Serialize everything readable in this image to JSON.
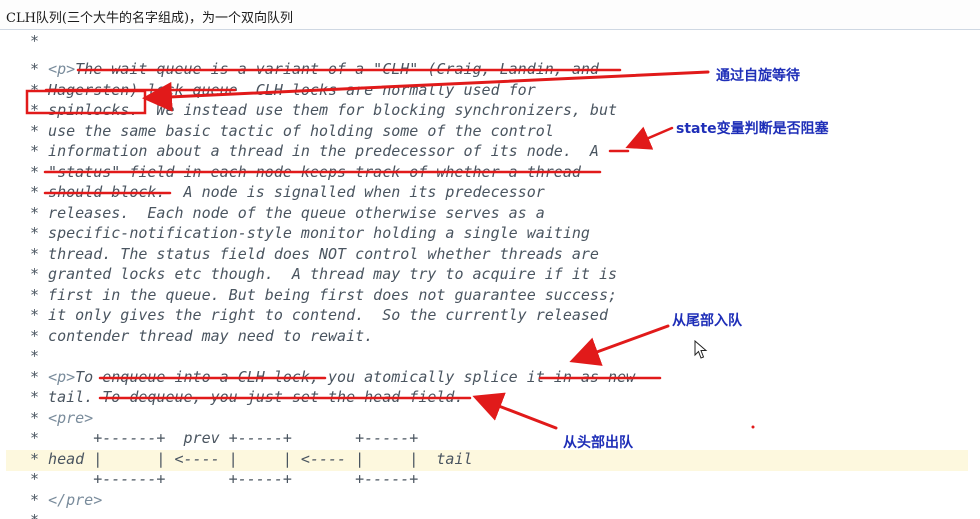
{
  "window": {
    "title": "CLH队列(三个大牛的名字组成)，为一个双向队列"
  },
  "code": {
    "lines": [
      "*",
      "* <p>The wait queue is a variant of a \"CLH\" (Craig, Landin, and",
      "* Hagersten) lock queue. CLH locks are normally used for",
      "* spinlocks.  We instead use them for blocking synchronizers, but",
      "* use the same basic tactic of holding some of the control",
      "* information about a thread in the predecessor of its node.  A",
      "* \"status\" field in each node keeps track of whether a thread",
      "* should block.  A node is signalled when its predecessor",
      "* releases.  Each node of the queue otherwise serves as a",
      "* specific-notification-style monitor holding a single waiting",
      "* thread. The status field does NOT control whether threads are",
      "* granted locks etc though.  A thread may try to acquire if it is",
      "* first in the queue. But being first does not guarantee success;",
      "* it only gives the right to contend.  So the currently released",
      "* contender thread may need to rewait.",
      "*",
      "* <p>To enqueue into a CLH lock, you atomically splice it in as new",
      "* tail. To dequeue, you just set the head field.",
      "* <pre>",
      "*      +------+  prev +-----+       +-----+",
      "* head |      | <---- |     | <---- |     |  tail",
      "*      +------+       +-----+       +-----+",
      "* </pre>",
      "*"
    ]
  },
  "annotations": {
    "spin_wait": "通过自旋等待",
    "state_block": "state变量判断是否阻塞",
    "enqueue_tail": "从尾部入队",
    "dequeue_head": "从头部出队"
  },
  "colors": {
    "annotation": "#1f2fb8",
    "underline": "#e11a1a",
    "highlight": "#fdf8de"
  }
}
